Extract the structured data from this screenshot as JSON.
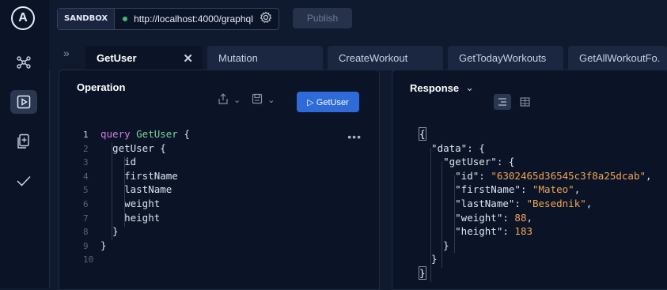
{
  "app": {
    "logo_letter": "A",
    "sandbox_label": "SANDBOX",
    "url": "http://localhost:4000/graphql",
    "publish_label": "Publish"
  },
  "tabs": [
    {
      "label": "GetUser",
      "active": true
    },
    {
      "label": "Mutation",
      "active": false
    },
    {
      "label": "CreateWorkout",
      "active": false
    },
    {
      "label": "GetTodayWorkouts",
      "active": false
    },
    {
      "label": "GetAllWorkoutFo.",
      "active": false
    }
  ],
  "tab_close_glyph": "✕",
  "operation": {
    "title": "Operation",
    "run_label": "▷ GetUser",
    "line_numbers": [
      "1",
      "2",
      "3",
      "4",
      "5",
      "6",
      "7",
      "8",
      "9",
      "10"
    ],
    "code": [
      {
        "t": "query",
        "n": "GetUser",
        "tail": " {"
      },
      {
        "f": "  getUser",
        "tail": " {"
      },
      {
        "f": "    id"
      },
      {
        "f": "    firstName"
      },
      {
        "f": "    lastName"
      },
      {
        "f": "    weight"
      },
      {
        "f": "    height"
      },
      {
        "f": "  }"
      },
      {
        "f": "}"
      },
      {
        "f": ""
      }
    ]
  },
  "response": {
    "title": "Response",
    "json_lines": [
      {
        "p": "{"
      },
      {
        "k": "  \"data\"",
        "p": ": {"
      },
      {
        "k": "    \"getUser\"",
        "p": ": {"
      },
      {
        "k": "      \"id\"",
        "p": ": ",
        "s": "\"6302465d36545c3f8a25dcab\"",
        "e": ","
      },
      {
        "k": "      \"firstName\"",
        "p": ": ",
        "s": "\"Mateo\"",
        "e": ","
      },
      {
        "k": "      \"lastName\"",
        "p": ": ",
        "s": "\"Besednik\"",
        "e": ","
      },
      {
        "k": "      \"weight\"",
        "p": ": ",
        "n": "88",
        "e": ","
      },
      {
        "k": "      \"height\"",
        "p": ": ",
        "n": "183"
      },
      {
        "p": "    }"
      },
      {
        "p": "  }"
      },
      {
        "p": "}"
      }
    ]
  },
  "icons": {
    "rail": [
      "schema-graph-icon",
      "explorer-play-icon",
      "docs-icon",
      "checkmark-icon"
    ],
    "top": [
      "settings-gear-icon"
    ]
  },
  "colors": {
    "background": "#0f1a2e",
    "panel": "#0b1426",
    "accent_button": "#2e6bd8",
    "status_dot": "#38c172",
    "string_value": "#f0a45a"
  }
}
